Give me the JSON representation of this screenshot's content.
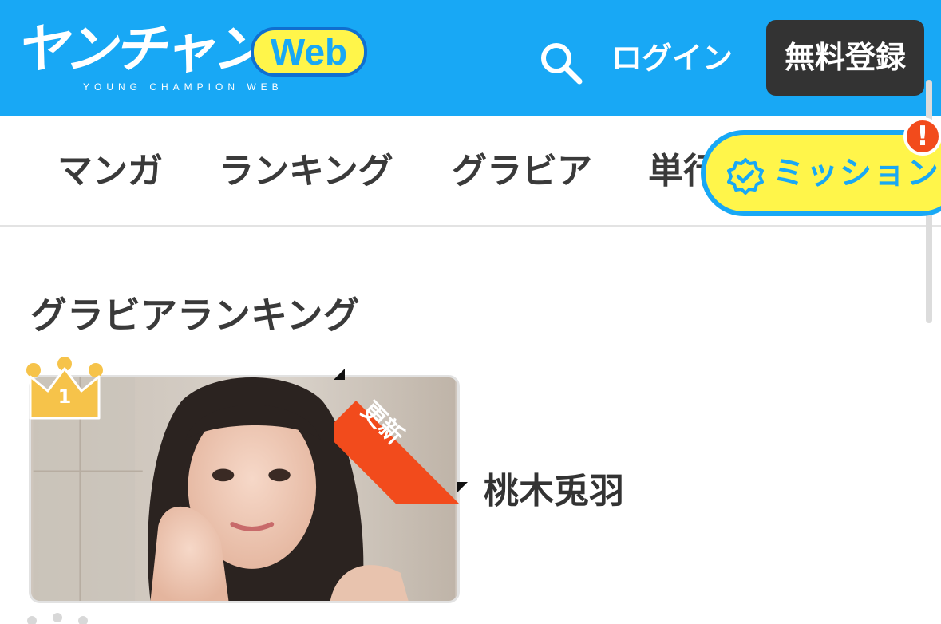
{
  "header": {
    "logo_text": "ヤンチャン",
    "logo_web": "Web",
    "logo_sub": "YOUNG CHAMPION WEB",
    "login_label": "ログイン",
    "register_label": "無料登録"
  },
  "nav": {
    "items": [
      "マンガ",
      "ランキング",
      "グラビア",
      "単行本"
    ],
    "mission_label": "ミッション",
    "alert_label": "!"
  },
  "section": {
    "title": "グラビアランキング"
  },
  "ranking": [
    {
      "rank": "1",
      "badge": "更新",
      "name": "桃木兎羽"
    }
  ],
  "colors": {
    "brand_blue": "#18a8f5",
    "mission_yellow": "#fff54a",
    "ribbon_red": "#f24b1c",
    "crown_gold": "#f6c34a"
  }
}
